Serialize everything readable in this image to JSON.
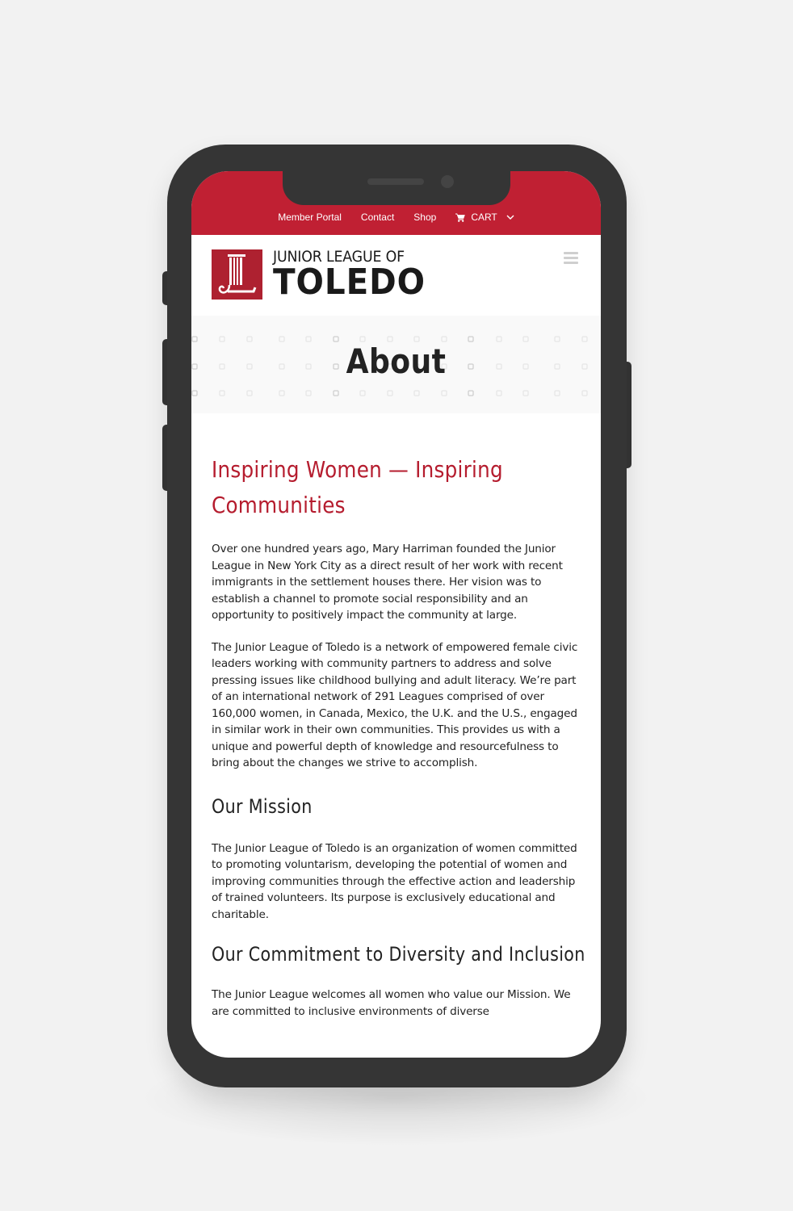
{
  "topnav": {
    "items": [
      "Member Portal",
      "Contact",
      "Shop"
    ],
    "cart_label": "CART"
  },
  "brand": {
    "line1": "JUNIOR LEAGUE OF",
    "line2": "TOLEDO",
    "colors": {
      "primary": "#c02033",
      "logo": "#ae2130",
      "heading": "#b51c2e"
    }
  },
  "page": {
    "title": "About"
  },
  "content": {
    "heading": "Inspiring Women — Inspiring Communities",
    "paragraphs": [
      "Over one hundred years ago, Mary Harriman founded the Junior League in New York City as a direct result of her work with recent immigrants in the settlement houses there. Her vision was to establish a channel to promote social responsibility and an opportunity to positively impact the community at large.",
      "The Junior League of Toledo is a network of empowered female civic leaders working with community partners to address and solve pressing issues like childhood bullying and adult literacy. We’re part of an international network of 291 Leagues comprised of over 160,000 women, in Canada, Mexico, the U.K. and the U.S., engaged in similar work in their own communities. This provides us with a unique and powerful depth of knowledge and resourcefulness to bring about the changes we strive to accomplish."
    ],
    "mission": {
      "heading": "Our Mission",
      "text": "The Junior League of Toledo is an organization of women committed to promoting voluntarism, developing the potential of women and improving communities through the effective action and leadership of trained volunteers. Its purpose is exclusively educational and charitable."
    },
    "diversity": {
      "heading": "Our Commitment to Diversity and Inclusion",
      "text": "The Junior League welcomes all women who value our Mission. We are committed to inclusive environments of diverse"
    }
  }
}
